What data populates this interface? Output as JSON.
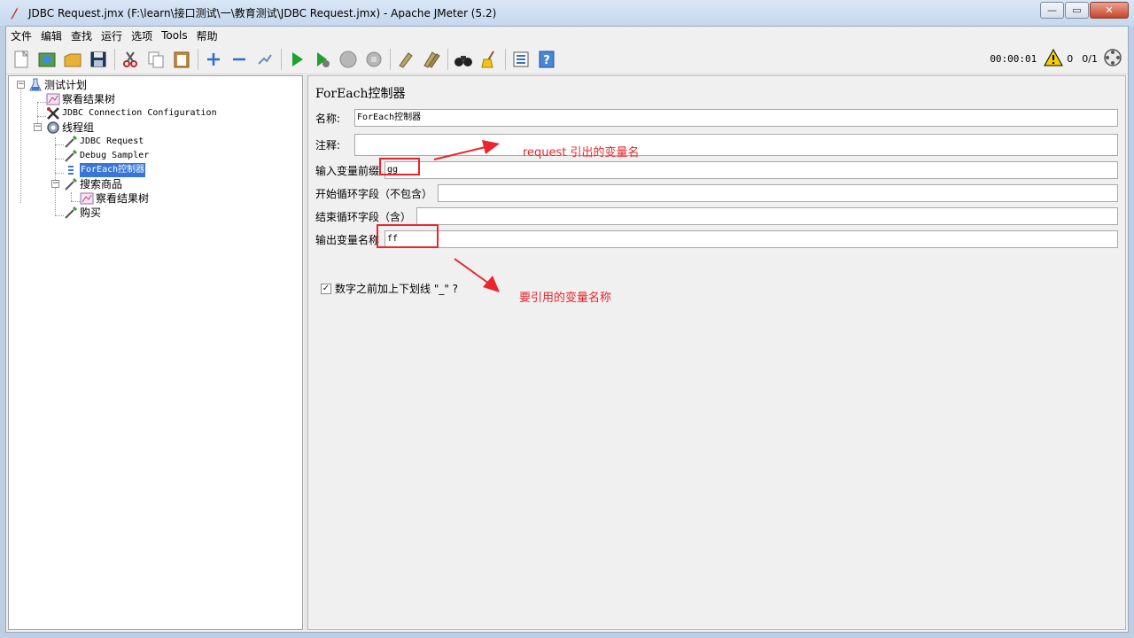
{
  "window": {
    "title": "JDBC Request.jmx (F:\\learn\\接口测试\\一\\教育测试\\JDBC Request.jmx) - Apache JMeter (5.2)",
    "minimize": "—",
    "restore": "▭",
    "close": "✕"
  },
  "menu": {
    "items": [
      "文件",
      "编辑",
      "查找",
      "运行",
      "选项",
      "Tools",
      "帮助"
    ]
  },
  "toolbar": {
    "timer": "00:00:01",
    "warnings": "0",
    "threads": "0/1"
  },
  "tree": {
    "nodes": [
      {
        "label": "测试计划",
        "icon": "test-plan-icon"
      },
      {
        "label": "察看结果树",
        "icon": "results-tree-icon"
      },
      {
        "label": "JDBC Connection Configuration",
        "icon": "config-tools-icon"
      },
      {
        "label": "线程组",
        "icon": "thread-group-gear-icon"
      },
      {
        "label": "JDBC Request",
        "icon": "sampler-pipette-icon"
      },
      {
        "label": "Debug Sampler",
        "icon": "sampler-pipette-icon"
      },
      {
        "label": "ForEach控制器",
        "icon": "foreach-controller-icon"
      },
      {
        "label": "搜索商品",
        "icon": "sampler-pipette-icon"
      },
      {
        "label": "察看结果树",
        "icon": "results-tree-icon"
      },
      {
        "label": "购买",
        "icon": "sampler-pipette-icon"
      }
    ]
  },
  "panel": {
    "title": "ForEach控制器",
    "name_label": "名称:",
    "name_value": "ForEach控制器",
    "comment_label": "注释:",
    "comment_value": "",
    "input_prefix_label": "输入变量前缀",
    "input_prefix_value": "gg",
    "start_label": "开始循环字段（不包含）",
    "start_value": "",
    "end_label": "结束循环字段（含）",
    "end_value": "",
    "output_label": "输出变量名称",
    "output_value": "ff",
    "checkbox_label": "数字之前加上下划线 \"_\" ?",
    "checkbox_checked": true
  },
  "annotations": {
    "note1": "request 引出的变量名",
    "note2": "要引用的变量名称",
    "color": "#e8262b"
  }
}
